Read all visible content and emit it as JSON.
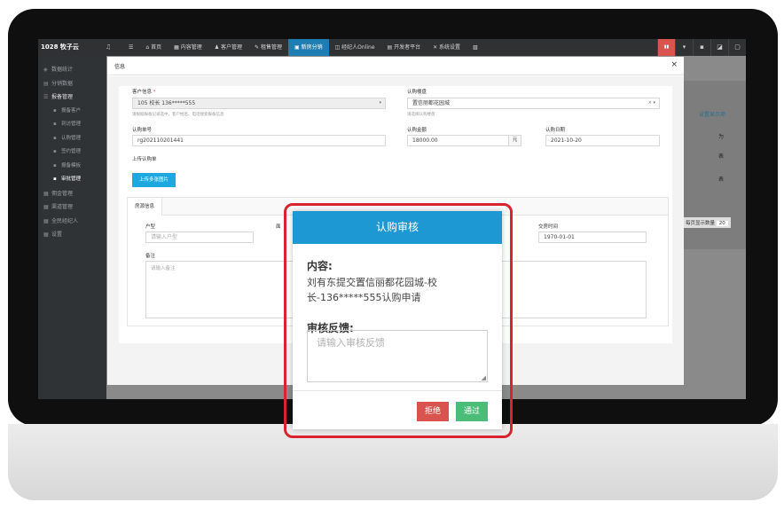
{
  "app": {
    "logo": "1028 牧子云",
    "nav": [
      "首页",
      "内容管理",
      "客户管理",
      "租售管理",
      "新房分销",
      "经纪人Online",
      "开发者平台",
      "系统设置"
    ],
    "nav_active_index": 4
  },
  "sidebar": {
    "items": [
      {
        "label": "数据统计",
        "level": 1
      },
      {
        "label": "分销数据",
        "level": 1
      },
      {
        "label": "报备管理",
        "level": 1,
        "open": true
      },
      {
        "label": "报备客户",
        "level": 2
      },
      {
        "label": "到访管理",
        "level": 2
      },
      {
        "label": "认购管理",
        "level": 2
      },
      {
        "label": "签约管理",
        "level": 2
      },
      {
        "label": "报备模板",
        "level": 2
      },
      {
        "label": "审批管理",
        "level": 2,
        "current": true
      },
      {
        "label": "佣金管理",
        "level": 1
      },
      {
        "label": "渠道管理",
        "level": 1
      },
      {
        "label": "全民经纪人",
        "level": 1
      },
      {
        "label": "设置",
        "level": 1
      }
    ]
  },
  "background": {
    "link": "设置显示项",
    "row_labels": [
      "为",
      "表",
      "表"
    ],
    "page_size_label": "每页显示数量",
    "page_size": "20"
  },
  "modal": {
    "title": "信息",
    "close": "×",
    "customer_label": "客户信息",
    "customer_value": "105 校长 136*****555",
    "customer_hint": "请根据报备记录选中，客户姓名、电话搜索报备信息",
    "project_label": "认购楼盘",
    "project_value": "置信丽都花园城",
    "project_hint": "请选择认购楼盘",
    "order_label": "认购单号",
    "order_value": "rg202110201441",
    "amount_label": "认购金额",
    "amount_value": "18000.00",
    "amount_unit": "元",
    "date_label": "认购日期",
    "date_value": "2021-10-20",
    "upload_label": "上传认购单",
    "upload_button": "上传多张图片",
    "tab": "房源信息",
    "room_label": "户型",
    "room_placeholder": "请输入户型",
    "area_label_partial": "面",
    "handover_label": "交房时间",
    "handover_value": "1970-01-01",
    "remark_label": "备注",
    "remark_placeholder": "请输入备注"
  },
  "dialog": {
    "title": "认购审核",
    "content_label": "内容:",
    "content_text": "刘有东提交置信丽都花园城-校长-136*****555认购申请",
    "feedback_label": "审核反馈:",
    "feedback_placeholder": "请输入审核反馈",
    "reject_button": "拒绝",
    "pass_button": "通过"
  }
}
